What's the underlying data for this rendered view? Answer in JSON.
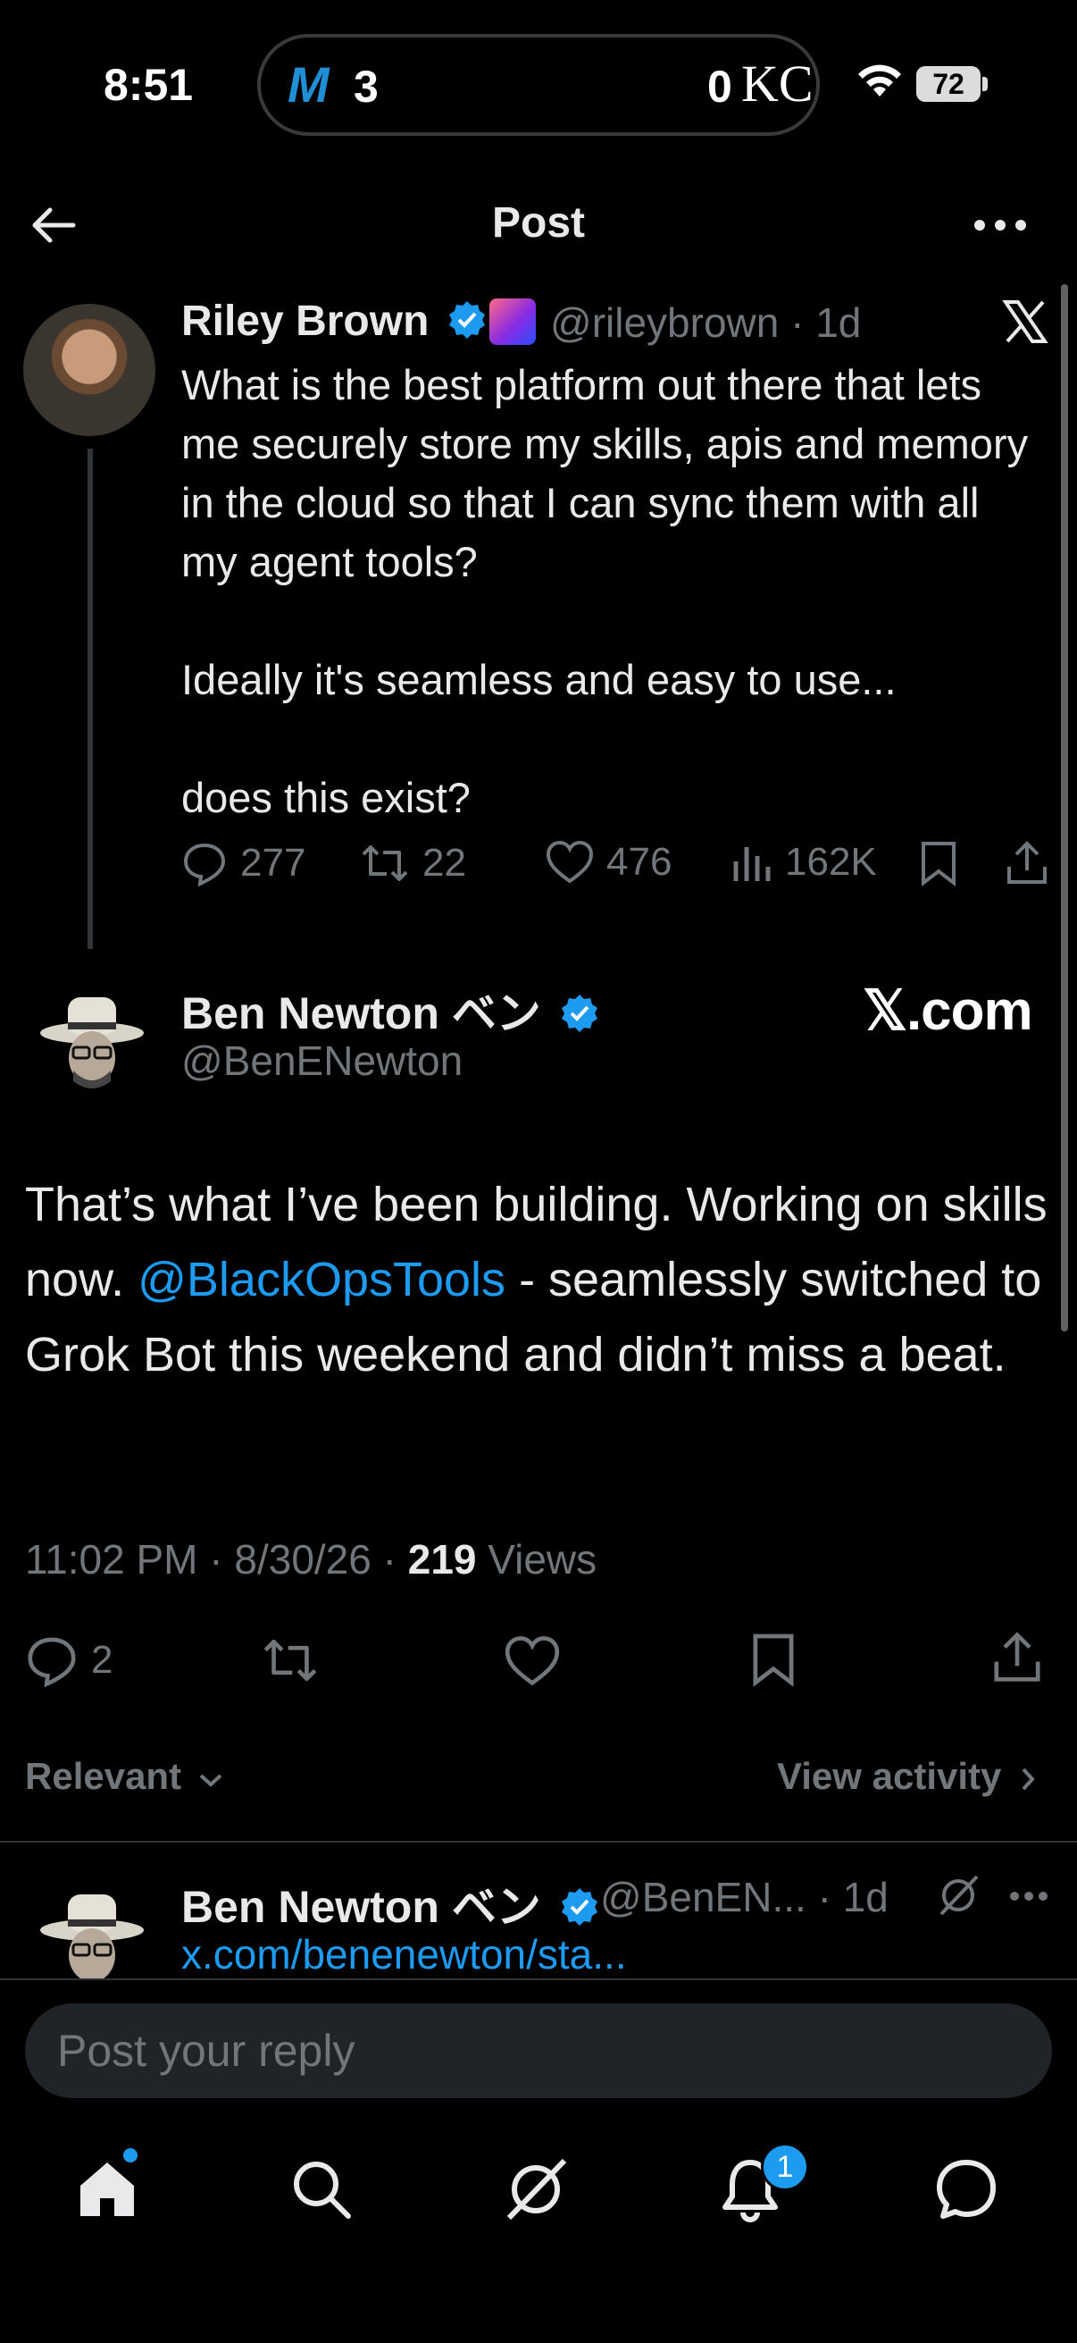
{
  "status_bar": {
    "time": "8:51",
    "live_activity": {
      "team1_logo": "M",
      "score1": "3",
      "score2": "0",
      "team2_logo": "KC"
    },
    "battery": "72"
  },
  "header": {
    "title": "Post"
  },
  "parent_post": {
    "author_name": "Riley Brown",
    "handle": "@rileybrown",
    "time": "· 1d",
    "text": "What is the best platform out there that lets me securely store my skills, apis and memory in the cloud so that I can sync them with all my agent tools?\n\nIdeally it's seamless and easy to use...\n\ndoes this exist?",
    "replies": "277",
    "reposts": "22",
    "likes": "476",
    "views": "162K"
  },
  "main_post": {
    "author_name": "Ben Newton ベン",
    "handle": "@BenENewton",
    "profile_link": "𝕏.com",
    "text_before": "That’s what I’ve been building. Working on skills now. ",
    "mention": "@BlackOpsTools",
    "text_after": " - seamlessly switched to Grok Bot this weekend and didn’t miss a beat.",
    "time": "11:02 PM",
    "date": "8/30/26",
    "views_count": "219",
    "views_label": "Views",
    "replies": "2"
  },
  "replies_section": {
    "sort_label": "Relevant",
    "view_activity": "View activity"
  },
  "reply_preview": {
    "author_name": "Ben Newton ベン",
    "handle": "@BenEN...",
    "time": "· 1d",
    "link": "x.com/benenewton/sta..."
  },
  "composer": {
    "placeholder": "Post your reply"
  },
  "tab_bar": {
    "notifications_count": "1"
  },
  "colors": {
    "accent": "#1d9bf0",
    "muted": "#71767b",
    "text": "#e7e9ea",
    "background": "#000000"
  }
}
